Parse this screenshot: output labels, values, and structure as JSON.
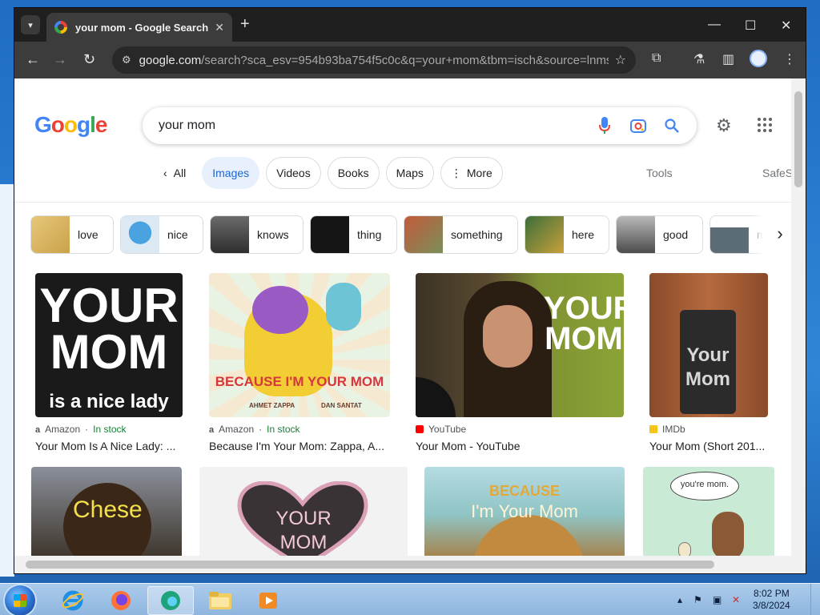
{
  "browser": {
    "tab_title": "your mom - Google Search",
    "url_host": "google.com",
    "url_path": "/search?sca_esv=954b93ba754f5c0c&q=your+mom&tbm=isch&source=lnms&s..."
  },
  "search": {
    "logo_letters": [
      "G",
      "o",
      "o",
      "g",
      "l",
      "e"
    ],
    "query": "your mom"
  },
  "filters": {
    "all_label": "All",
    "chips": [
      "Images",
      "Videos",
      "Books",
      "Maps",
      "More"
    ],
    "active": "Images",
    "tools_label": "Tools",
    "safesearch_label": "SafeS"
  },
  "suggestions": [
    "love",
    "nice",
    "knows",
    "thing",
    "something",
    "here",
    "good",
    "m"
  ],
  "results": [
    {
      "source": "Amazon",
      "stock": "In stock",
      "caption": "Your Mom Is A Nice Lady: ...",
      "art": [
        "YOUR",
        "MOM",
        "is a nice lady"
      ]
    },
    {
      "source": "Amazon",
      "stock": "In stock",
      "caption": "Because I'm Your Mom: Zappa, A...",
      "art": [
        "BECAUSE I'M YOUR MOM",
        "AHMET ZAPPA",
        "DAN SANTAT"
      ]
    },
    {
      "source": "YouTube",
      "caption": "Your Mom - YouTube",
      "art": [
        "YOUR",
        "MOM"
      ]
    },
    {
      "source": "IMDb",
      "caption": "Your Mom (Short 201...",
      "art": [
        "Your",
        "Mom"
      ]
    },
    {
      "art": [
        "Chese"
      ]
    },
    {
      "art": [
        "YOUR",
        "MOM"
      ]
    },
    {
      "art": [
        "BECAUSE",
        "I'm Your Mom"
      ]
    },
    {
      "art": [
        "you're mom."
      ]
    }
  ],
  "taskbar": {
    "time": "8:02 PM",
    "date": "3/8/2024"
  },
  "colors": {
    "chip_active_bg": "#e8f0fe",
    "chip_active_text": "#1967d2",
    "in_stock": "#188038"
  }
}
